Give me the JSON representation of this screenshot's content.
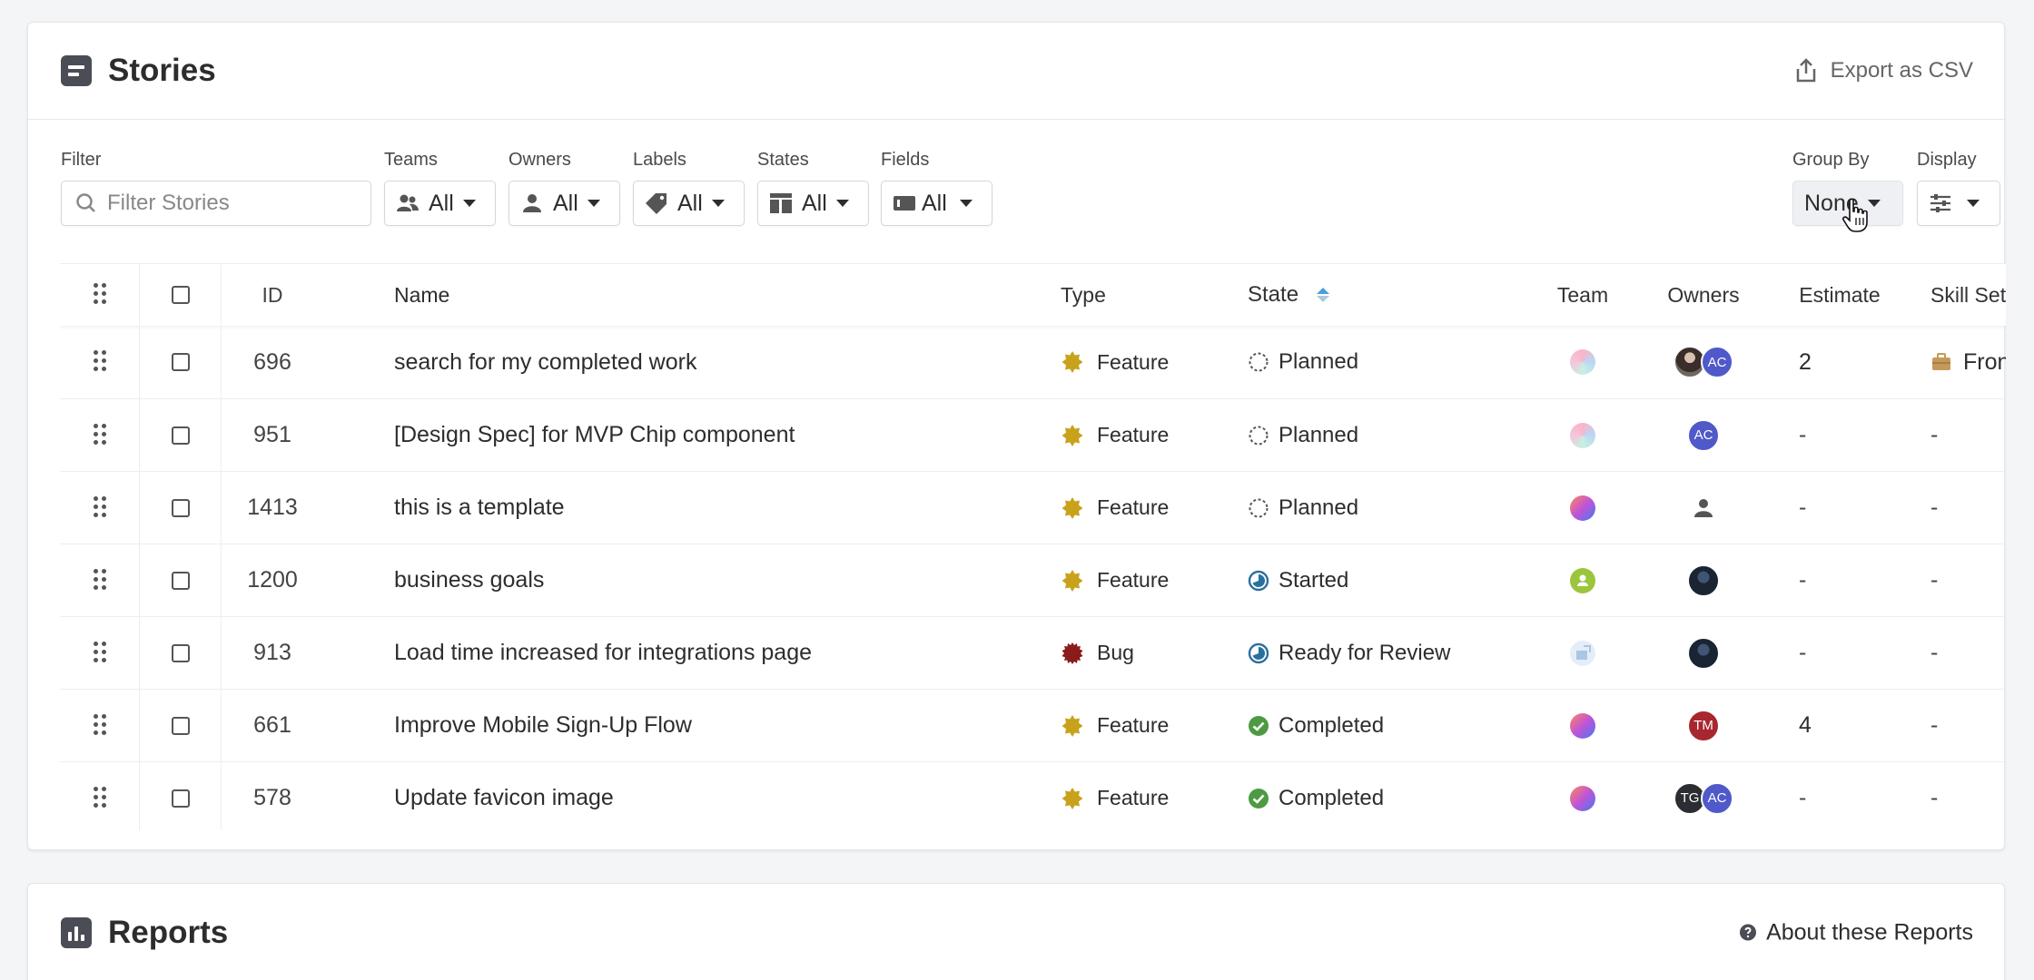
{
  "stories": {
    "title": "Stories",
    "export_label": "Export as CSV",
    "filters": {
      "filter_label": "Filter",
      "filter_placeholder": "Filter Stories",
      "teams": {
        "label": "Teams",
        "value": "All"
      },
      "owners": {
        "label": "Owners",
        "value": "All"
      },
      "labels": {
        "label": "Labels",
        "value": "All"
      },
      "states": {
        "label": "States",
        "value": "All"
      },
      "fields": {
        "label": "Fields",
        "value": "All"
      },
      "group_by": {
        "label": "Group By",
        "value": "None"
      },
      "display": {
        "label": "Display"
      }
    },
    "columns": {
      "id": "ID",
      "name": "Name",
      "type": "Type",
      "state": "State",
      "team": "Team",
      "owners": "Owners",
      "estimate": "Estimate",
      "skill_set": "Skill Set"
    },
    "rows": [
      {
        "id": "696",
        "name": "search for my completed work",
        "type": "Feature",
        "state": "Planned",
        "team": "pastel",
        "owners": [
          "photo",
          "AC"
        ],
        "estimate": "2",
        "skill": "Fron"
      },
      {
        "id": "951",
        "name": "[Design Spec] for MVP Chip component",
        "type": "Feature",
        "state": "Planned",
        "team": "pastel",
        "owners": [
          "AC"
        ],
        "estimate": "-",
        "skill": "-"
      },
      {
        "id": "1413",
        "name": "this is a template",
        "type": "Feature",
        "state": "Planned",
        "team": "gradient",
        "owners": [
          "person"
        ],
        "estimate": "-",
        "skill": "-"
      },
      {
        "id": "1200",
        "name": "business goals",
        "type": "Feature",
        "state": "Started",
        "team": "green",
        "owners": [
          "dark"
        ],
        "estimate": "-",
        "skill": "-"
      },
      {
        "id": "913",
        "name": "Load time increased for integrations page",
        "type": "Bug",
        "state": "Ready for Review",
        "team": "light",
        "owners": [
          "dark"
        ],
        "estimate": "-",
        "skill": "-"
      },
      {
        "id": "661",
        "name": "Improve Mobile Sign-Up Flow",
        "type": "Feature",
        "state": "Completed",
        "team": "gradient",
        "owners": [
          "TM"
        ],
        "estimate": "4",
        "skill": "-"
      },
      {
        "id": "578",
        "name": "Update favicon image",
        "type": "Feature",
        "state": "Completed",
        "team": "gradient",
        "owners": [
          "TG",
          "AC"
        ],
        "estimate": "-",
        "skill": "-"
      }
    ]
  },
  "reports": {
    "title": "Reports",
    "about_label": "About these Reports"
  },
  "colors": {
    "feature": "#c9a21c",
    "bug": "#8b1a1a",
    "completed": "#4d9a43",
    "started": "#2b6f9e",
    "avatar_ac": "#5059c9",
    "avatar_tm": "#a8262f",
    "avatar_tg": "#2b2d33"
  }
}
